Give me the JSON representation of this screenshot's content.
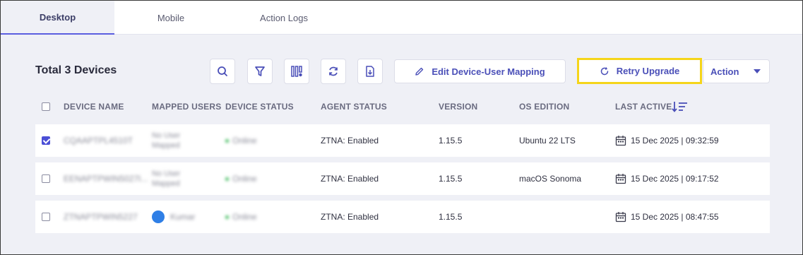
{
  "tabs": [
    {
      "label": "Desktop",
      "active": true
    },
    {
      "label": "Mobile",
      "active": false
    },
    {
      "label": "Action Logs",
      "active": false
    }
  ],
  "title": "Total 3 Devices",
  "toolbar": {
    "icons": [
      "search-icon",
      "filter-icon",
      "columns-settings-icon",
      "refresh-icon",
      "export-icon"
    ],
    "edit_label": "Edit Device-User Mapping",
    "retry_label": "Retry Upgrade",
    "action_label": "Action"
  },
  "columns": [
    "DEVICE NAME",
    "MAPPED USERS",
    "DEVICE STATUS",
    "AGENT STATUS",
    "VERSION",
    "OS EDITION",
    "LAST ACTIVE"
  ],
  "rows": [
    {
      "checked": true,
      "device_name": "CQAAPTPL4510T",
      "mapped_line1": "No User",
      "mapped_line2": "Mapped",
      "status": "Online",
      "agent": "ZTNA: Enabled",
      "version": "1.15.5",
      "os": "Ubuntu 22 LTS",
      "last_active": "15 Dec 2025 | 09:32:59"
    },
    {
      "checked": false,
      "device_name": "EENAPTPWIN5027I...",
      "mapped_line1": "No User",
      "mapped_line2": "Mapped",
      "status": "Online",
      "agent": "ZTNA: Enabled",
      "version": "1.15.5",
      "os": "macOS Sonoma",
      "last_active": "15 Dec 2025 | 09:17:52"
    },
    {
      "checked": false,
      "device_name": "ZTNAPTPWIN5227",
      "mapped_user": "Kumar",
      "status": "Online",
      "agent": "ZTNA: Enabled",
      "version": "1.15.5",
      "os": "",
      "last_active": "15 Dec 2025 | 08:47:55"
    }
  ],
  "colors": {
    "accent": "#4b4fd6",
    "highlight": "#f5d51a",
    "online": "#3cba5a"
  }
}
